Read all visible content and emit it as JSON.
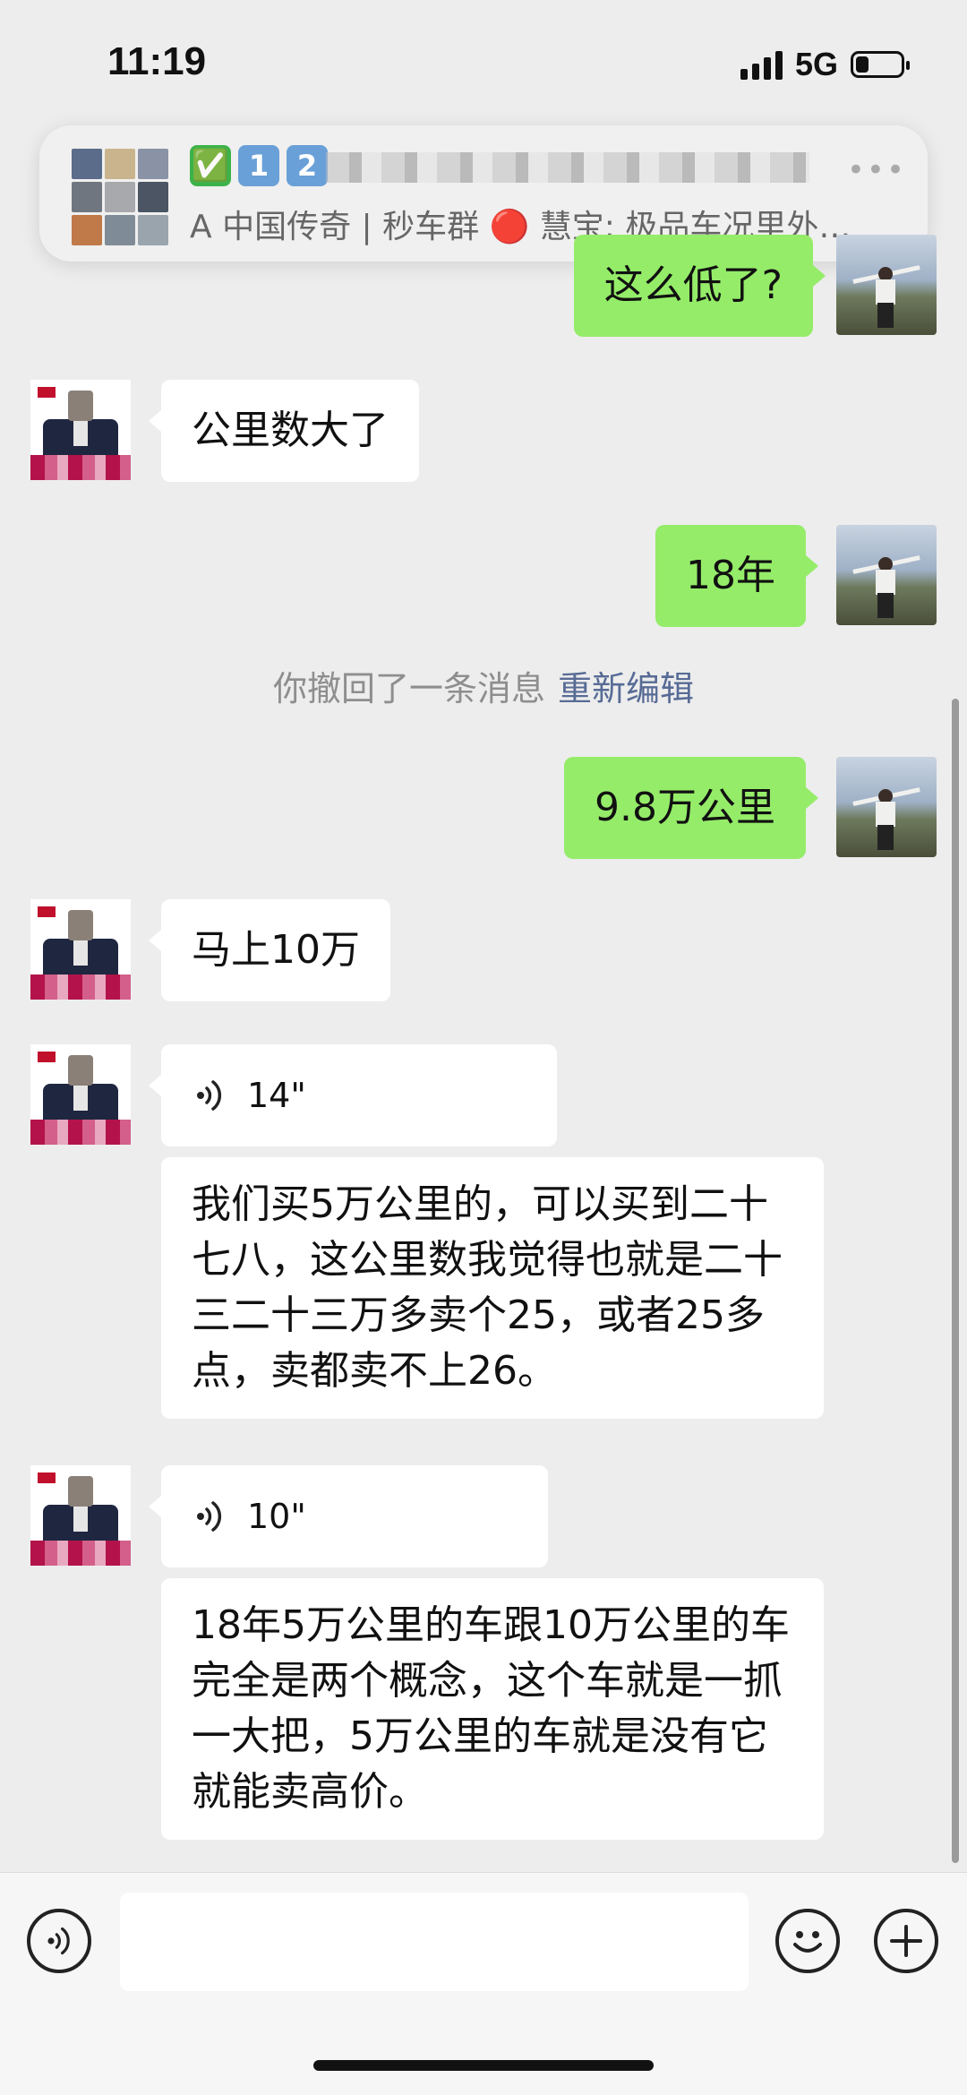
{
  "status_bar": {
    "time": "11:19",
    "network": "5G",
    "battery_level": 0.3
  },
  "notification": {
    "badges": [
      "✅",
      "1",
      "2"
    ],
    "more_icon": "more-dots-icon",
    "preview": "A 中国传奇 | 秒车群 🔴 慧宝: 极品车况里外…"
  },
  "messages": [
    {
      "from": "me",
      "type": "text",
      "text": "这么低了?"
    },
    {
      "from": "other",
      "type": "text",
      "text": "公里数大了"
    },
    {
      "from": "me",
      "type": "text",
      "text": "18年"
    },
    {
      "from": "system",
      "text": "你撤回了一条消息",
      "link": "重新编辑"
    },
    {
      "from": "me",
      "type": "text",
      "text": "9.8万公里"
    },
    {
      "from": "other",
      "type": "text",
      "text": "马上10万"
    },
    {
      "from": "other",
      "type": "voice",
      "duration": "14\""
    },
    {
      "from": "other",
      "type": "text",
      "text": "我们买5万公里的，可以买到二十七八，这公里数我觉得也就是二十三二十三万多卖个25，或者25多点，卖都卖不上26。"
    },
    {
      "from": "other",
      "type": "voice",
      "duration": "10\""
    },
    {
      "from": "other",
      "type": "text",
      "text": "18年5万公里的车跟10万公里的车完全是两个概念，这个车就是一抓一大把，5万公里的车就是没有它就能卖高价。"
    }
  ],
  "input_bar": {
    "voice_icon": "voice-input-icon",
    "emoji_icon": "emoji-icon",
    "plus_icon": "plus-icon",
    "placeholder": ""
  },
  "colors": {
    "background": "#ededed",
    "outgoing_bubble": "#95ec69",
    "incoming_bubble": "#ffffff",
    "link": "#576b95"
  }
}
